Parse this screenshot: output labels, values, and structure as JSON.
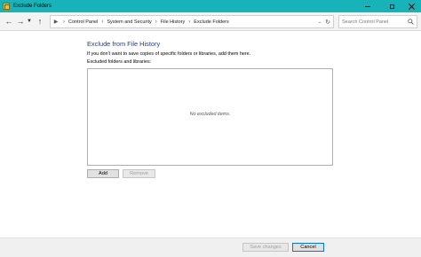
{
  "window": {
    "title": "Exclude Folders",
    "accent_color": "#17b3b9"
  },
  "nav": {
    "back_icon": "arrow-left-icon",
    "forward_icon": "arrow-right-icon",
    "recent_icon": "chevron-down-icon",
    "up_icon": "arrow-up-icon",
    "breadcrumbs": [
      "Control Panel",
      "System and Security",
      "File History",
      "Exclude Folders"
    ],
    "search_placeholder": "Search Control Panel"
  },
  "main": {
    "title": "Exclude from File History",
    "title_color": "#1e3f8c",
    "description": "If you don't want to save copies of specific folders or libraries, add them here.",
    "list_label": "Excluded folders and libraries:",
    "empty_text": "No excluded items.",
    "add_label": "Add",
    "remove_label": "Remove"
  },
  "footer": {
    "save_label": "Save changes",
    "cancel_label": "Cancel"
  }
}
